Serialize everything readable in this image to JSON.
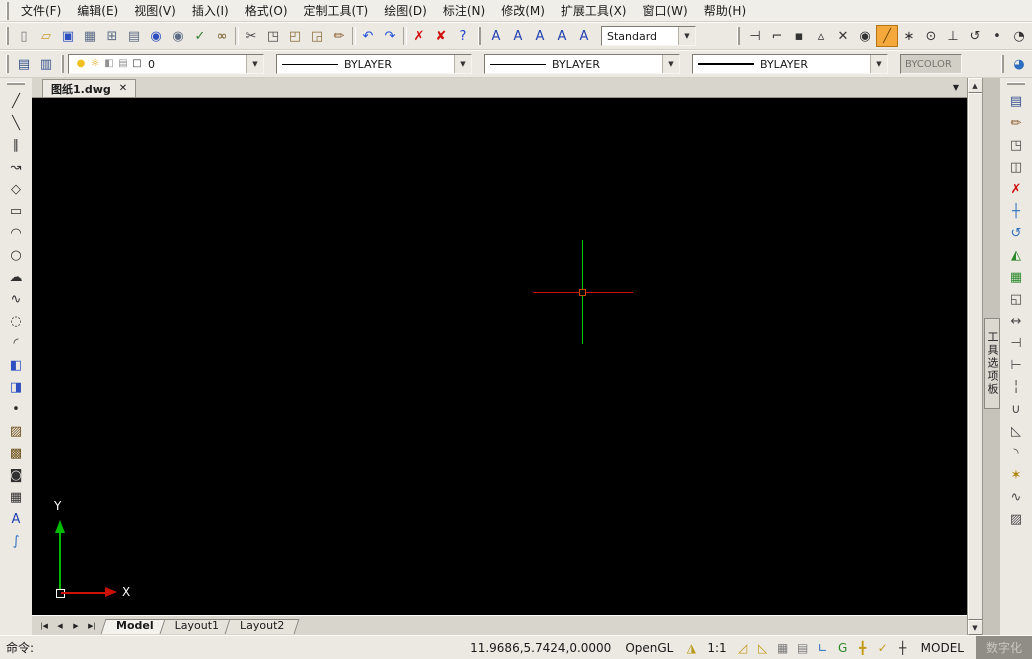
{
  "ui": {
    "dropdown_arrow": "▼",
    "scroll_up": "▲",
    "scroll_down": "▼",
    "close_glyph": "✕"
  },
  "menubar": {
    "items": [
      {
        "name": "menu-file",
        "label": "文件(F)"
      },
      {
        "name": "menu-edit",
        "label": "编辑(E)"
      },
      {
        "name": "menu-view",
        "label": "视图(V)"
      },
      {
        "name": "menu-insert",
        "label": "插入(I)"
      },
      {
        "name": "menu-format",
        "label": "格式(O)"
      },
      {
        "name": "menu-custom-tools",
        "label": "定制工具(T)"
      },
      {
        "name": "menu-draw",
        "label": "绘图(D)"
      },
      {
        "name": "menu-dimension",
        "label": "标注(N)"
      },
      {
        "name": "menu-modify",
        "label": "修改(M)"
      },
      {
        "name": "menu-express-tools",
        "label": "扩展工具(X)"
      },
      {
        "name": "menu-window",
        "label": "窗口(W)"
      },
      {
        "name": "menu-help",
        "label": "帮助(H)"
      }
    ]
  },
  "toolbar_standard": {
    "icons": [
      {
        "name": "new-file-icon",
        "glyph": "▯",
        "color": "#7a7a7a"
      },
      {
        "name": "open-file-icon",
        "glyph": "▱",
        "color": "#c89a2a"
      },
      {
        "name": "save-icon",
        "glyph": "▣",
        "color": "#2e4fbf"
      },
      {
        "name": "plot-icon",
        "glyph": "▦",
        "color": "#5d6d86"
      },
      {
        "name": "print-preview-icon",
        "glyph": "⊞",
        "color": "#5d6d86"
      },
      {
        "name": "publish-icon",
        "glyph": "▤",
        "color": "#5d6d86"
      },
      {
        "name": "find-icon",
        "glyph": "◉",
        "color": "#2e4fbf"
      },
      {
        "name": "search-page-icon",
        "glyph": "◉",
        "color": "#5d6d86"
      },
      {
        "name": "spell-check-icon",
        "glyph": "✓",
        "color": "#2e7d32"
      },
      {
        "name": "binoculars-icon",
        "glyph": "∞",
        "color": "#6b4e16"
      },
      {
        "sep": true
      },
      {
        "name": "cut-icon",
        "glyph": "✂",
        "color": "#444444"
      },
      {
        "name": "copy-icon",
        "glyph": "◳",
        "color": "#4a4a4a"
      },
      {
        "name": "paste-icon",
        "glyph": "◰",
        "color": "#8a6d3b"
      },
      {
        "name": "paste-special-icon",
        "glyph": "◲",
        "color": "#8a6d3b"
      },
      {
        "name": "match-properties-icon",
        "glyph": "✏",
        "color": "#8a5a2b"
      },
      {
        "sep": true
      },
      {
        "name": "undo-icon",
        "glyph": "↶",
        "color": "#1f4fd8"
      },
      {
        "name": "redo-icon",
        "glyph": "↷",
        "color": "#1f4fd8"
      },
      {
        "sep": true
      },
      {
        "name": "cancel-icon",
        "glyph": "✗",
        "color": "#d01010"
      },
      {
        "name": "cancel-all-icon",
        "glyph": "✘",
        "color": "#d01010"
      },
      {
        "name": "help-icon",
        "glyph": "?",
        "color": "#1f3fd0"
      }
    ]
  },
  "text_toolbar": {
    "icons": [
      {
        "name": "dtext-icon",
        "glyph": "A",
        "color": "#1f3fb0"
      },
      {
        "name": "mtext-icon",
        "glyph": "A",
        "color": "#1f3fb0"
      },
      {
        "name": "edit-text-icon",
        "glyph": "A",
        "color": "#1f3fb0"
      },
      {
        "name": "text-style-icon",
        "glyph": "A",
        "color": "#1f3fb0"
      },
      {
        "name": "scale-text-icon",
        "glyph": "A",
        "color": "#1f3fb0"
      }
    ],
    "style_value": "Standard"
  },
  "osnap_toolbar": {
    "icons": [
      {
        "name": "temp-track-point-icon",
        "glyph": "⊣",
        "color": "#333333"
      },
      {
        "name": "snap-from-icon",
        "glyph": "⌐",
        "color": "#333333"
      },
      {
        "name": "snap-endpoint-icon",
        "glyph": "▪",
        "color": "#333333"
      },
      {
        "name": "snap-midpoint-icon",
        "glyph": "▵",
        "color": "#333333"
      },
      {
        "name": "snap-intersection-icon",
        "glyph": "✕",
        "color": "#333333"
      },
      {
        "name": "zoom-window-icon",
        "glyph": "◉",
        "color": "#333333"
      },
      {
        "name": "snap-nearest-icon",
        "glyph": "╱",
        "color": "#7a4a00",
        "highlight": true
      },
      {
        "name": "snap-apparent-intersection-icon",
        "glyph": "∗",
        "color": "#333333"
      },
      {
        "name": "snap-center-icon",
        "glyph": "⊙",
        "color": "#333333"
      },
      {
        "name": "snap-perpendicular-icon",
        "glyph": "⊥",
        "color": "#333333"
      },
      {
        "name": "snap-tangent-icon",
        "glyph": "↺",
        "color": "#333333"
      },
      {
        "name": "snap-node-icon",
        "glyph": "•",
        "color": "#333333"
      },
      {
        "name": "snap-settings-icon",
        "glyph": "◔",
        "color": "#333333"
      }
    ]
  },
  "properties_toolbar": {
    "layer_tool_icons": [
      {
        "name": "layer-properties-icon",
        "glyph": "▤",
        "color": "#33518e"
      },
      {
        "name": "layer-states-icon",
        "glyph": "▥",
        "color": "#33518e"
      }
    ],
    "layer_state_icons": [
      {
        "name": "layer-on-icon",
        "glyph": "●",
        "color": "#f0c020"
      },
      {
        "name": "layer-freeze-icon",
        "glyph": "☼",
        "color": "#e0a000"
      },
      {
        "name": "layer-lock-icon",
        "glyph": "◧",
        "color": "#909090"
      },
      {
        "name": "layer-plot-icon",
        "glyph": "▤",
        "color": "#909090"
      },
      {
        "name": "layer-color-icon",
        "glyph": "□",
        "color": "#303030"
      }
    ],
    "layer_value": "0",
    "color_value": "BYLAYER",
    "linetype_value": "BYLAYER",
    "lineweight_value": "BYLAYER",
    "plot_style_value": "BYCOLOR",
    "extra_icons": [
      {
        "name": "clean-screen-icon",
        "glyph": "◕",
        "color": "#2e6fbf"
      }
    ]
  },
  "draw_toolbar": {
    "icons": [
      {
        "name": "line-icon",
        "glyph": "╱",
        "color": "#303030"
      },
      {
        "name": "construction-line-icon",
        "glyph": "╲",
        "color": "#303030"
      },
      {
        "name": "multiline-icon",
        "glyph": "∥",
        "color": "#303030"
      },
      {
        "name": "polyline-icon",
        "glyph": "↝",
        "color": "#303030"
      },
      {
        "name": "polygon-icon",
        "glyph": "◇",
        "color": "#303030"
      },
      {
        "name": "rectangle-icon",
        "glyph": "▭",
        "color": "#303030"
      },
      {
        "name": "arc-icon",
        "glyph": "◠",
        "color": "#303030"
      },
      {
        "name": "circle-icon",
        "glyph": "○",
        "color": "#303030"
      },
      {
        "name": "revcloud-icon",
        "glyph": "☁",
        "color": "#303030"
      },
      {
        "name": "spline-icon",
        "glyph": "∿",
        "color": "#303030"
      },
      {
        "name": "ellipse-icon",
        "glyph": "◌",
        "color": "#303030"
      },
      {
        "name": "ellipse-arc-icon",
        "glyph": "◜",
        "color": "#303030"
      },
      {
        "name": "insert-block-icon",
        "glyph": "◧",
        "color": "#2e4fbf"
      },
      {
        "name": "make-block-icon",
        "glyph": "◨",
        "color": "#2e4fbf"
      },
      {
        "name": "point-icon",
        "glyph": "•",
        "color": "#303030"
      },
      {
        "name": "hatch-icon",
        "glyph": "▨",
        "color": "#6b4e16"
      },
      {
        "name": "gradient-icon",
        "glyph": "▩",
        "color": "#6b4e16"
      },
      {
        "name": "region-icon",
        "glyph": "◙",
        "color": "#303030"
      },
      {
        "name": "table-icon",
        "glyph": "▦",
        "color": "#303030"
      },
      {
        "name": "mtext-icon",
        "glyph": "A",
        "color": "#1f3fb0"
      },
      {
        "name": "sketch-icon",
        "glyph": "∫",
        "color": "#2e6fbf"
      }
    ]
  },
  "modify_toolbar": {
    "icons": [
      {
        "name": "properties-icon",
        "glyph": "▤",
        "color": "#33518e"
      },
      {
        "name": "match-properties-icon",
        "glyph": "✏",
        "color": "#8a5a2b"
      },
      {
        "name": "copy-icon",
        "glyph": "◳",
        "color": "#4a4a4a"
      },
      {
        "name": "offset-icon",
        "glyph": "◫",
        "color": "#4a4a4a"
      },
      {
        "name": "erase-icon",
        "glyph": "✗",
        "color": "#d01010"
      },
      {
        "name": "move-icon",
        "glyph": "┼",
        "color": "#2e6fbf"
      },
      {
        "name": "rotate-icon",
        "glyph": "↺",
        "color": "#2e6fbf"
      },
      {
        "name": "mirror-icon",
        "glyph": "◭",
        "color": "#2a8a2a"
      },
      {
        "name": "array-icon",
        "glyph": "▦",
        "color": "#2a8a2a"
      },
      {
        "name": "scale-icon",
        "glyph": "◱",
        "color": "#4a4a4a"
      },
      {
        "name": "stretch-icon",
        "glyph": "↔",
        "color": "#4a4a4a"
      },
      {
        "name": "trim-icon",
        "glyph": "⊣",
        "color": "#4a4a4a"
      },
      {
        "name": "extend-icon",
        "glyph": "⊢",
        "color": "#4a4a4a"
      },
      {
        "name": "break-icon",
        "glyph": "╎",
        "color": "#4a4a4a"
      },
      {
        "name": "join-icon",
        "glyph": "∪",
        "color": "#4a4a4a"
      },
      {
        "name": "chamfer-icon",
        "glyph": "◺",
        "color": "#4a4a4a"
      },
      {
        "name": "fillet-icon",
        "glyph": "◝",
        "color": "#4a4a4a"
      },
      {
        "name": "explode-icon",
        "glyph": "✶",
        "color": "#b08000"
      },
      {
        "name": "edit-polyline-icon",
        "glyph": "∿",
        "color": "#4a4a4a"
      },
      {
        "name": "edit-hatch-icon",
        "glyph": "▨",
        "color": "#4a4a4a"
      }
    ]
  },
  "drawing_tab": {
    "title": "图纸1.dwg"
  },
  "palette": {
    "label": "工具选项板"
  },
  "canvas": {
    "ucs": {
      "x_label": "X",
      "y_label": "Y"
    }
  },
  "layout_bar": {
    "nav": [
      {
        "name": "first-tab-button",
        "glyph": "|◀"
      },
      {
        "name": "prev-tab-button",
        "glyph": "◀"
      },
      {
        "name": "next-tab-button",
        "glyph": "▶"
      },
      {
        "name": "last-tab-button",
        "glyph": "▶|"
      }
    ],
    "tabs": [
      {
        "name": "model-tab",
        "label": "Model",
        "active": true
      },
      {
        "name": "layout1-tab",
        "label": "Layout1"
      },
      {
        "name": "layout2-tab",
        "label": "Layout2"
      }
    ]
  },
  "statusbar": {
    "command": "命令:",
    "coords": "11.9686,5.7424,0.0000",
    "opengl": "OpenGL",
    "graphics_icons": [
      {
        "name": "graphics-triangle-icon",
        "glyph": "◮",
        "color": "#b89a18"
      }
    ],
    "scale": "1:1",
    "toggle_icons": [
      {
        "name": "snap-toggle-icon",
        "glyph": "◿",
        "color": "#c09a18"
      },
      {
        "name": "grid-toggle-icon",
        "glyph": "◺",
        "color": "#c09a18"
      },
      {
        "name": "ortho-toggle-icon",
        "glyph": "▦",
        "color": "#7a7a7a"
      },
      {
        "name": "polar-toggle-icon",
        "glyph": "▤",
        "color": "#7a7a7a"
      },
      {
        "name": "osnap-toggle-icon",
        "glyph": "∟",
        "color": "#2e6fbf"
      },
      {
        "name": "otrack-toggle-icon",
        "glyph": "G",
        "color": "#2a8a2a"
      },
      {
        "name": "lineweight-toggle-icon",
        "glyph": "╋",
        "color": "#c09a18"
      },
      {
        "name": "dyn-toggle-icon",
        "glyph": "✓",
        "color": "#c09a18"
      },
      {
        "name": "fullscreen-icon",
        "glyph": "┼",
        "color": "#222222"
      }
    ],
    "model": "MODEL",
    "digitizer": "数字化"
  }
}
